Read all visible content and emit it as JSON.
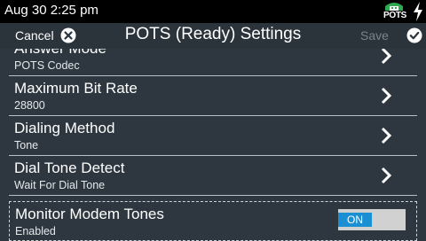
{
  "status_bar": {
    "time": "Aug 30 2:25 pm",
    "pots_icon_text": "POTS",
    "pots_icon": "pots-phone-icon",
    "bolt_icon": "charging-bolt-icon"
  },
  "header": {
    "title": "POTS (Ready) Settings",
    "cancel_label": "Cancel",
    "cancel_icon": "close-circle-icon",
    "save_label": "Save",
    "save_icon": "check-circle-icon"
  },
  "settings": [
    {
      "title": "Answer Mode",
      "value": "POTS Codec",
      "control": "chevron"
    },
    {
      "title": "Maximum Bit Rate",
      "value": "28800",
      "control": "chevron"
    },
    {
      "title": "Dialing Method",
      "value": "Tone",
      "control": "chevron"
    },
    {
      "title": "Dial Tone Detect",
      "value": "Wait For Dial Tone",
      "control": "chevron"
    },
    {
      "title": "Monitor Modem Tones",
      "value": "Enabled",
      "control": "toggle",
      "toggle_label": "ON",
      "toggle_state": true
    }
  ],
  "colors": {
    "background": "#2e373f",
    "status_bar": "#000000",
    "toggle_on": "#1b8fd3",
    "toggle_track": "#d1d1d1",
    "save_disabled": "#7a848c"
  }
}
